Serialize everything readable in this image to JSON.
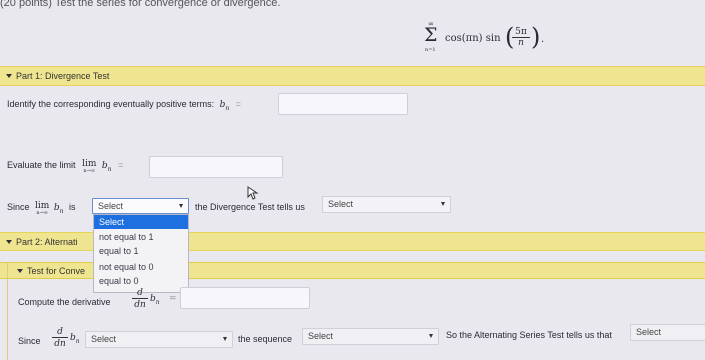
{
  "header": {
    "question_text": "(20 points) Test the series for convergence or divergence."
  },
  "series": {
    "sigma": "Σ",
    "upper": "∞",
    "lower": "n=1",
    "cos_term": "cos(πn) sin",
    "frac_num": "5π",
    "frac_den": "n"
  },
  "part1": {
    "title": "Part 1: Divergence Test",
    "identify_prompt": "Identify the corresponding eventually positive terms:",
    "bn": "b",
    "bn_sub": "n",
    "equals": "=",
    "evaluate_prompt": "Evaluate the limit",
    "lim_word": "lim",
    "lim_sub": "n→∞",
    "since_word": "Since",
    "is_word": "is",
    "select_label": "Select",
    "divergence_tells": "the Divergence Test tells us",
    "select2_label": "Select"
  },
  "dropdown": {
    "options": [
      "Select",
      "not equal to 1",
      "equal to 1",
      "not equal to 0",
      "equal to 0"
    ]
  },
  "part2": {
    "title": "Part 2: Alternati"
  },
  "part3": {
    "title": "Test for Conve"
  },
  "derivative": {
    "compute_prompt": "Compute the derivative",
    "d": "d",
    "dn": "dn",
    "since_word": "Since",
    "select_label": "Select",
    "sequence_text": "the sequence",
    "select2_label": "Select",
    "ast_text": "So the Alternating Series Test tells us that",
    "select3_label": "Select"
  }
}
